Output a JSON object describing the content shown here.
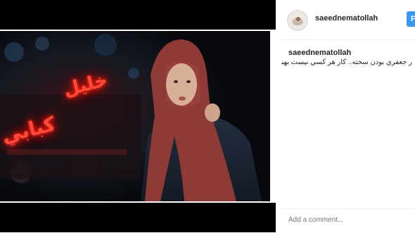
{
  "post": {
    "username": "saeednematollah",
    "follow_label": "F",
    "caption": {
      "username": "saeednematollah",
      "separator": ".",
      "text": "ر جعفري بودن سخته.. كار هر كسي نيست بهنال بودن"
    },
    "comment_placeholder": "Add a comment..."
  },
  "photo": {
    "neon_sign_lines": [
      "خليل",
      "كبابي"
    ]
  },
  "colors": {
    "follow_button": "#3897f0",
    "neon": "#ff4a3a",
    "scarf": "#8e3a36"
  }
}
